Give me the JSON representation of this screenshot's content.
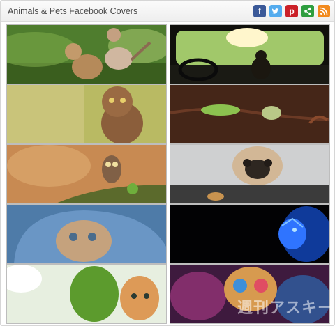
{
  "header": {
    "title": "Animals & Pets Facebook Covers",
    "share_icons": [
      "facebook-icon",
      "twitter-icon",
      "pinterest-icon",
      "share-icon",
      "rss-icon"
    ]
  },
  "covers": [
    {
      "subject": "kittens playing"
    },
    {
      "subject": "cat in car"
    },
    {
      "subject": "owl"
    },
    {
      "subject": "chameleons"
    },
    {
      "subject": "small owl"
    },
    {
      "subject": "pug"
    },
    {
      "subject": "kitten in blanket"
    },
    {
      "subject": "neon leopard"
    },
    {
      "subject": "kitten in clover"
    },
    {
      "subject": "painted dog"
    }
  ],
  "watermark": "週刊アスキー"
}
